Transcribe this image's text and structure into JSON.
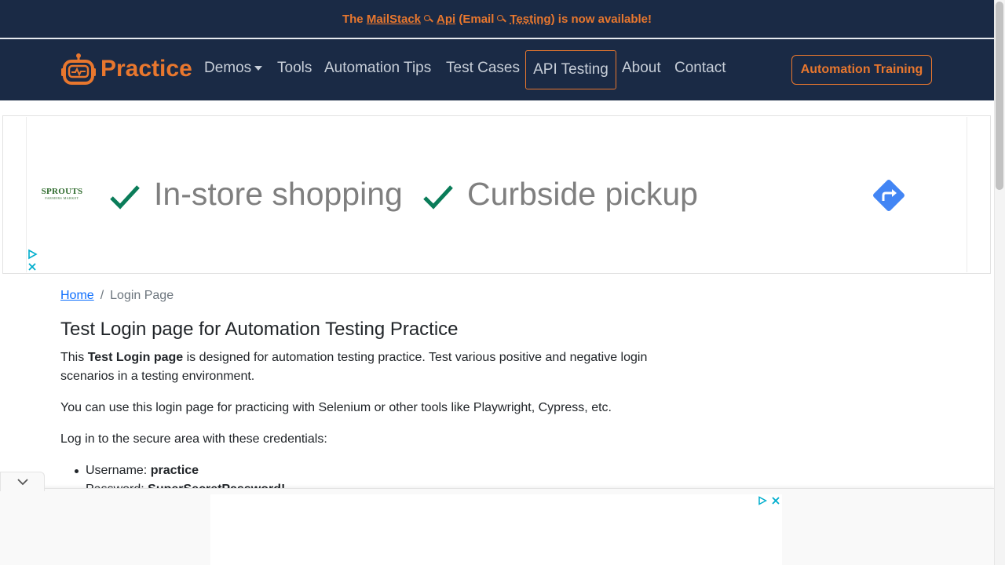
{
  "announcement": {
    "prefix": "The",
    "link_mailstack": "MailStack",
    "link_api": "Api",
    "middle": "(Email",
    "link_testing": "Testing",
    "suffix": ") is now available!"
  },
  "navbar": {
    "brand": "Practice",
    "items": [
      {
        "label": "Demos"
      },
      {
        "label": "Tools"
      },
      {
        "label": "Automation Tips"
      },
      {
        "label": "Test Cases"
      },
      {
        "label": "API Testing"
      },
      {
        "label": "About"
      },
      {
        "label": "Contact"
      }
    ],
    "cta": "Automation Training"
  },
  "ad": {
    "advertiser": "SPROUTS",
    "advertiser_sub": "FARMERS MARKET",
    "feature1": "In-store shopping",
    "feature2": "Curbside pickup",
    "colors": {
      "check": "#0a7c59",
      "directions": "#4285f4",
      "ad_choices": "#00aecd"
    }
  },
  "breadcrumb": {
    "home": "Home",
    "current": "Login Page"
  },
  "main": {
    "title": "Test Login page for Automation Testing Practice",
    "p1_before": "This",
    "p1_bold": "Test Login page",
    "p1_after": "is designed for automation testing practice. Test various positive and negative login scenarios in a testing environment.",
    "p2": "You can use this login page for practicing with Selenium or other tools like Playwright, Cypress, etc.",
    "p3": "Log in to the secure area with these credentials:",
    "creds": [
      {
        "label": "Username:",
        "value": "practice"
      },
      {
        "label": "Password:",
        "value": "SuperSecretPassword!"
      }
    ]
  },
  "theme": {
    "navy": "#1a2a45",
    "accent": "#e8772e",
    "link": "#0d6efd"
  }
}
